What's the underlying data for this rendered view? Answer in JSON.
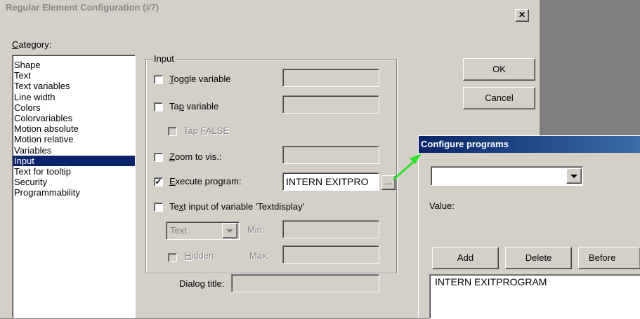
{
  "main_dialog": {
    "title": "Regular Element Configuration (#7)",
    "close_glyph": "✕",
    "category_label_accel": "C",
    "category_label_rest": "ategory:",
    "categories": [
      "Shape",
      "Text",
      "Text variables",
      "Line width",
      "Colors",
      "Colorvariables",
      "Motion absolute",
      "Motion relative",
      "Variables",
      "Input",
      "Text for tooltip",
      "Security",
      "Programmability"
    ],
    "selected_category": "Input",
    "input_group": {
      "legend": "Input",
      "toggle_variable": {
        "pre": "",
        "accel": "T",
        "post": "oggle variable",
        "checked": false,
        "value": ""
      },
      "tap_variable": {
        "pre": "Ta",
        "accel": "p",
        "post": " variable",
        "checked": false,
        "value": ""
      },
      "tap_false": {
        "pre": "Tap ",
        "accel": "F",
        "post": "ALSE",
        "checked": false,
        "enabled": false
      },
      "zoom_to_vis": {
        "pre": "",
        "accel": "Z",
        "post": "oom to vis.:",
        "checked": false,
        "value": ""
      },
      "execute_program": {
        "pre": "",
        "accel": "E",
        "post": "xecute program:",
        "checked": true,
        "value": "INTERN EXITPRO",
        "browse_label": "..."
      },
      "text_input": {
        "pre": "Te",
        "accel": "x",
        "post": "t input of variable 'Textdisplay'",
        "checked": false
      },
      "text_type": {
        "value": "Text"
      },
      "min_label": "Min:",
      "max_label": "Max:",
      "hidden": {
        "pre": "",
        "accel": "H",
        "post": "idden",
        "checked": false,
        "enabled": false
      },
      "dialog_title_label": "Dialog title:",
      "dialog_title_value": ""
    },
    "ok_label": "OK",
    "cancel_label": "Cancel"
  },
  "configure_programs": {
    "title": "Configure programs",
    "dropdown_value": "",
    "value_label": "Value:",
    "add_label": "Add",
    "delete_label": "Delete",
    "before_label": "Before",
    "programs": [
      "INTERN EXITPROGRAM"
    ]
  },
  "colors": {
    "title_active": "#0a246a",
    "selection": "#0a246a",
    "arrow": "#2ee02e",
    "face": "#d4d0c8"
  }
}
